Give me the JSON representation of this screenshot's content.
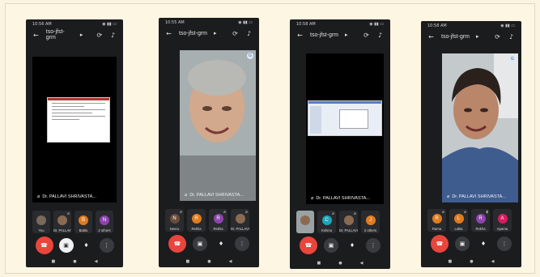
{
  "screens": [
    {
      "status_time": "10:56 AM",
      "meeting_code": "tso-jfst-grm",
      "tile_name": "Dr. PALLAVI SHRIVASTA...",
      "participants": [
        {
          "label": "You",
          "initial": "",
          "color": "#7a6a5a"
        },
        {
          "label": "Dr. PALLAVI",
          "initial": "",
          "color": "#8a6b52"
        },
        {
          "label": "Bablu",
          "initial": "B",
          "color": "#e07b1f"
        },
        {
          "label": "2 others",
          "initial": "N",
          "color": "#8e44ad"
        }
      ]
    },
    {
      "status_time": "10:55 AM",
      "meeting_code": "tso-jfst-grm",
      "tile_name": "Dr. PALLAVI SHRIVASTA...",
      "participants": [
        {
          "label": "Neeru",
          "initial": "N",
          "color": "#6b4c3b"
        },
        {
          "label": "Rekha",
          "initial": "R",
          "color": "#e07b1f"
        },
        {
          "label": "Rekha",
          "initial": "R",
          "color": "#8e44ad"
        },
        {
          "label": "Dr. PALLAVI",
          "initial": "",
          "color": "#8a6b52"
        }
      ]
    },
    {
      "status_time": "10:58 AM",
      "meeting_code": "tso-jfst-grm",
      "tile_name": "Dr. PALLAVI SHRIVASTA...",
      "participants": [
        {
          "label": "",
          "initial": "",
          "color": "#8a6b52"
        },
        {
          "label": "Kshma",
          "initial": "C",
          "color": "#1aa7b8"
        },
        {
          "label": "Dr. PALLAVI",
          "initial": "",
          "color": "#8a6b52"
        },
        {
          "label": "2 others",
          "initial": "J",
          "color": "#e07b1f"
        }
      ]
    },
    {
      "status_time": "10:58 AM",
      "meeting_code": "tso-jfst-grm",
      "tile_name": "Dr. PALLAVI SHRIVASTA...",
      "participants": [
        {
          "label": "Rama",
          "initial": "R",
          "color": "#e07b1f"
        },
        {
          "label": "Lalita",
          "initial": "L",
          "color": "#e07b1f"
        },
        {
          "label": "Rekha",
          "initial": "R",
          "color": "#8e44ad"
        },
        {
          "label": "Aparna",
          "initial": "A",
          "color": "#d81b60"
        }
      ]
    }
  ],
  "colors": {
    "end_call": "#e8453c",
    "panel": "#2a2b2e",
    "background": "#fbf4e0"
  },
  "icons": {
    "back": "arrow-left-icon",
    "switch_camera": "switch-camera-icon",
    "speaker": "speaker-icon",
    "end": "phone-hangup-icon",
    "camera": "camera-icon",
    "mic": "microphone-icon",
    "more": "more-vert-icon"
  }
}
